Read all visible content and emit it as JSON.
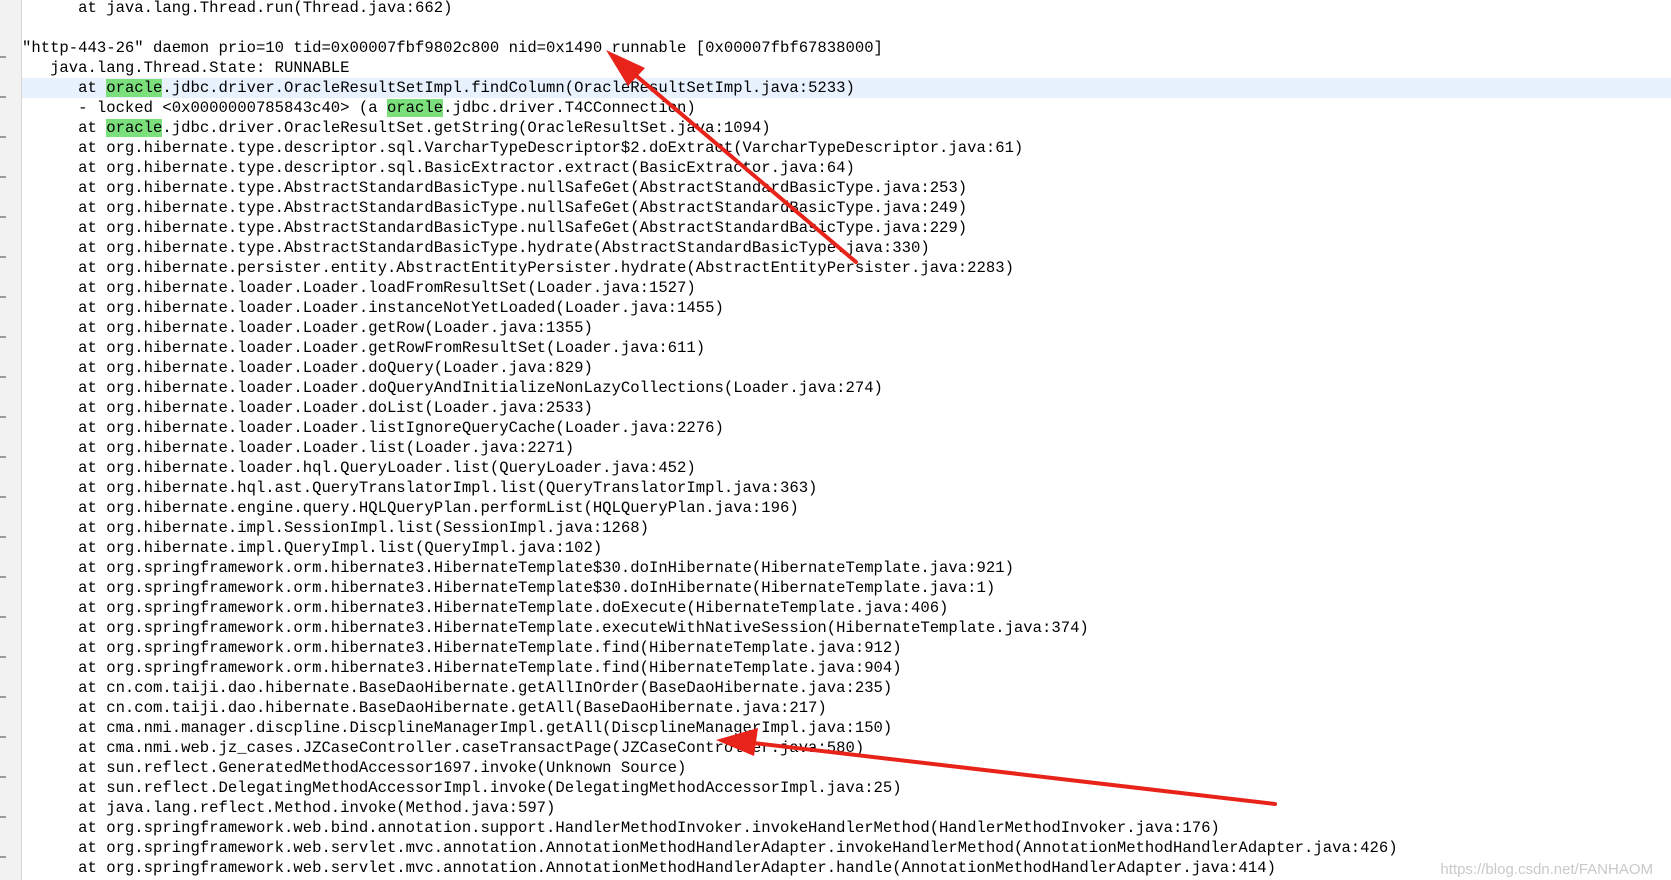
{
  "editor": {
    "lines": [
      {
        "text": "      at java.lang.Thread.run(Thread.java:662)"
      },
      {
        "text": ""
      },
      {
        "text": "\"http-443-26\" daemon prio=10 tid=0x00007fbf9802c800 nid=0x1490 runnable [0x00007fbf67838000]"
      },
      {
        "text": "   java.lang.Thread.State: RUNNABLE"
      },
      {
        "segments": [
          "      at ",
          "oracle",
          ".jdbc.driver.OracleResultSetImpl.findColumn(OracleResultSetImpl.java:5233)"
        ],
        "current": true
      },
      {
        "segments": [
          "      - locked <0x0000000785843c40> (a ",
          "oracle",
          ".jdbc.driver.T4CConnection)"
        ]
      },
      {
        "segments": [
          "      at ",
          "oracle",
          ".jdbc.driver.OracleResultSet.getString(OracleResultSet.java:1094)"
        ]
      },
      {
        "text": "      at org.hibernate.type.descriptor.sql.VarcharTypeDescriptor$2.doExtract(VarcharTypeDescriptor.java:61)"
      },
      {
        "text": "      at org.hibernate.type.descriptor.sql.BasicExtractor.extract(BasicExtractor.java:64)"
      },
      {
        "text": "      at org.hibernate.type.AbstractStandardBasicType.nullSafeGet(AbstractStandardBasicType.java:253)"
      },
      {
        "text": "      at org.hibernate.type.AbstractStandardBasicType.nullSafeGet(AbstractStandardBasicType.java:249)"
      },
      {
        "text": "      at org.hibernate.type.AbstractStandardBasicType.nullSafeGet(AbstractStandardBasicType.java:229)"
      },
      {
        "text": "      at org.hibernate.type.AbstractStandardBasicType.hydrate(AbstractStandardBasicType.java:330)"
      },
      {
        "text": "      at org.hibernate.persister.entity.AbstractEntityPersister.hydrate(AbstractEntityPersister.java:2283)"
      },
      {
        "text": "      at org.hibernate.loader.Loader.loadFromResultSet(Loader.java:1527)"
      },
      {
        "text": "      at org.hibernate.loader.Loader.instanceNotYetLoaded(Loader.java:1455)"
      },
      {
        "text": "      at org.hibernate.loader.Loader.getRow(Loader.java:1355)"
      },
      {
        "text": "      at org.hibernate.loader.Loader.getRowFromResultSet(Loader.java:611)"
      },
      {
        "text": "      at org.hibernate.loader.Loader.doQuery(Loader.java:829)"
      },
      {
        "text": "      at org.hibernate.loader.Loader.doQueryAndInitializeNonLazyCollections(Loader.java:274)"
      },
      {
        "text": "      at org.hibernate.loader.Loader.doList(Loader.java:2533)"
      },
      {
        "text": "      at org.hibernate.loader.Loader.listIgnoreQueryCache(Loader.java:2276)"
      },
      {
        "text": "      at org.hibernate.loader.Loader.list(Loader.java:2271)"
      },
      {
        "text": "      at org.hibernate.loader.hql.QueryLoader.list(QueryLoader.java:452)"
      },
      {
        "text": "      at org.hibernate.hql.ast.QueryTranslatorImpl.list(QueryTranslatorImpl.java:363)"
      },
      {
        "text": "      at org.hibernate.engine.query.HQLQueryPlan.performList(HQLQueryPlan.java:196)"
      },
      {
        "text": "      at org.hibernate.impl.SessionImpl.list(SessionImpl.java:1268)"
      },
      {
        "text": "      at org.hibernate.impl.QueryImpl.list(QueryImpl.java:102)"
      },
      {
        "text": "      at org.springframework.orm.hibernate3.HibernateTemplate$30.doInHibernate(HibernateTemplate.java:921)"
      },
      {
        "text": "      at org.springframework.orm.hibernate3.HibernateTemplate$30.doInHibernate(HibernateTemplate.java:1)"
      },
      {
        "text": "      at org.springframework.orm.hibernate3.HibernateTemplate.doExecute(HibernateTemplate.java:406)"
      },
      {
        "text": "      at org.springframework.orm.hibernate3.HibernateTemplate.executeWithNativeSession(HibernateTemplate.java:374)"
      },
      {
        "text": "      at org.springframework.orm.hibernate3.HibernateTemplate.find(HibernateTemplate.java:912)"
      },
      {
        "text": "      at org.springframework.orm.hibernate3.HibernateTemplate.find(HibernateTemplate.java:904)"
      },
      {
        "text": "      at cn.com.taiji.dao.hibernate.BaseDaoHibernate.getAllInOrder(BaseDaoHibernate.java:235)"
      },
      {
        "text": "      at cn.com.taiji.dao.hibernate.BaseDaoHibernate.getAll(BaseDaoHibernate.java:217)"
      },
      {
        "text": "      at cma.nmi.manager.discpline.DiscplineManagerImpl.getAll(DiscplineManagerImpl.java:150)"
      },
      {
        "text": "      at cma.nmi.web.jz_cases.JZCaseController.caseTransactPage(JZCaseController.java:580)"
      },
      {
        "text": "      at sun.reflect.GeneratedMethodAccessor1697.invoke(Unknown Source)"
      },
      {
        "text": "      at sun.reflect.DelegatingMethodAccessorImpl.invoke(DelegatingMethodAccessorImpl.java:25)"
      },
      {
        "text": "      at java.lang.reflect.Method.invoke(Method.java:597)"
      },
      {
        "text": "      at org.springframework.web.bind.annotation.support.HandlerMethodInvoker.invokeHandlerMethod(HandlerMethodInvoker.java:176)"
      },
      {
        "text": "      at org.springframework.web.servlet.mvc.annotation.AnnotationMethodHandlerAdapter.invokeHandlerMethod(AnnotationMethodHandlerAdapter.java:426)"
      },
      {
        "text": "      at org.springframework.web.servlet.mvc.annotation.AnnotationMethodHandlerAdapter.handle(AnnotationMethodHandlerAdapter.java:414)"
      }
    ],
    "highlight_color": "#7be07b"
  },
  "annotations": {
    "arrow_color": "#e8231a"
  },
  "watermark": "https://blog.csdn.net/FANHAOM"
}
